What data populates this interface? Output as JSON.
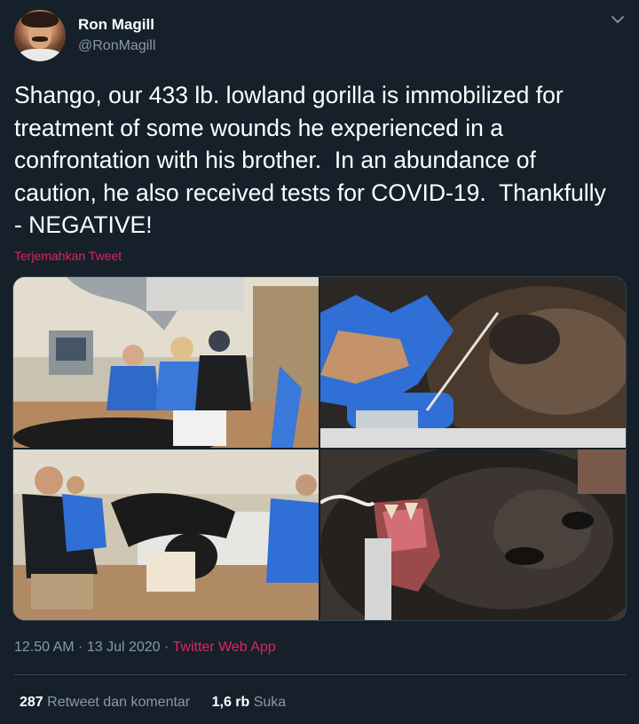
{
  "tweet": {
    "author": {
      "display_name": "Ron Magill",
      "handle": "@RonMagill"
    },
    "text": "Shango, our 433 lb. lowland gorilla is immobilized for\ntreatment of some wounds he experienced in a\nconfrontation with his brother.  In an abundance of\ncaution, he also received tests for COVID-19.  Thankfully\n- NEGATIVE!",
    "translate_label": "Terjemahkan Tweet",
    "timestamp": "12.50 AM · 13 Jul 2020",
    "separator": " · ",
    "source": "Twitter Web App",
    "stats": {
      "retweets_count": "287",
      "retweets_label": "Retweet dan komentar",
      "likes_count": "1,6 rb",
      "likes_label": "Suka"
    }
  },
  "colors": {
    "background": "#15202b",
    "secondary_text": "#8899a6",
    "accent": "#e0245e",
    "border": "#38444d"
  },
  "icons": {
    "menu": "chevron-down-icon"
  }
}
